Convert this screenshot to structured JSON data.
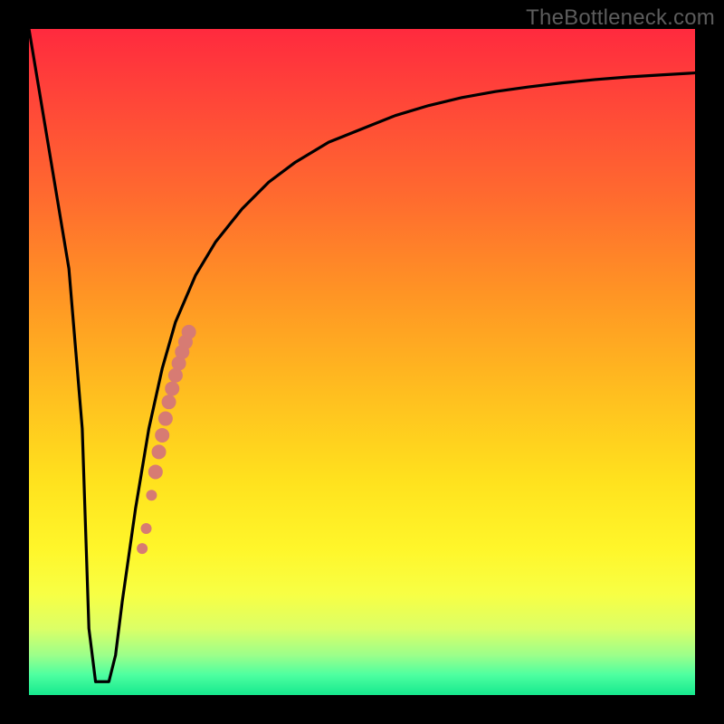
{
  "watermark": "TheBottleneck.com",
  "colors": {
    "frame": "#000000",
    "curve": "#000000",
    "dots": "#d77b73",
    "gradient_top": "#ff2a3e",
    "gradient_bottom": "#16e88e"
  },
  "chart_data": {
    "type": "line",
    "title": "",
    "xlabel": "",
    "ylabel": "",
    "xlim": [
      0,
      100
    ],
    "ylim": [
      0,
      100
    ],
    "grid": false,
    "legend": false,
    "series": [
      {
        "name": "bottleneck-curve",
        "x": [
          0,
          2,
          4,
          6,
          8,
          9,
          10,
          11,
          12,
          13,
          14,
          16,
          18,
          20,
          22,
          25,
          28,
          32,
          36,
          40,
          45,
          50,
          55,
          60,
          65,
          70,
          75,
          80,
          85,
          90,
          95,
          100
        ],
        "y": [
          100,
          88,
          76,
          64,
          40,
          10,
          2,
          2,
          2,
          6,
          14,
          28,
          40,
          49,
          56,
          63,
          68,
          73,
          77,
          80,
          83,
          85,
          87,
          88.5,
          89.7,
          90.6,
          91.3,
          91.9,
          92.4,
          92.8,
          93.1,
          93.4
        ]
      }
    ],
    "flat_bottom": {
      "x_start": 9,
      "x_end": 12,
      "y": 2
    },
    "highlight_dots": {
      "name": "highlight",
      "x": [
        17.0,
        17.6,
        18.4,
        19.0,
        19.5,
        20.0,
        20.5,
        21.0,
        21.5,
        22.0,
        22.5,
        23.0,
        23.5,
        24.0
      ],
      "y": [
        22.0,
        25.0,
        30.0,
        33.5,
        36.5,
        39.0,
        41.5,
        44.0,
        46.0,
        48.0,
        49.8,
        51.5,
        53.0,
        54.5
      ]
    }
  }
}
